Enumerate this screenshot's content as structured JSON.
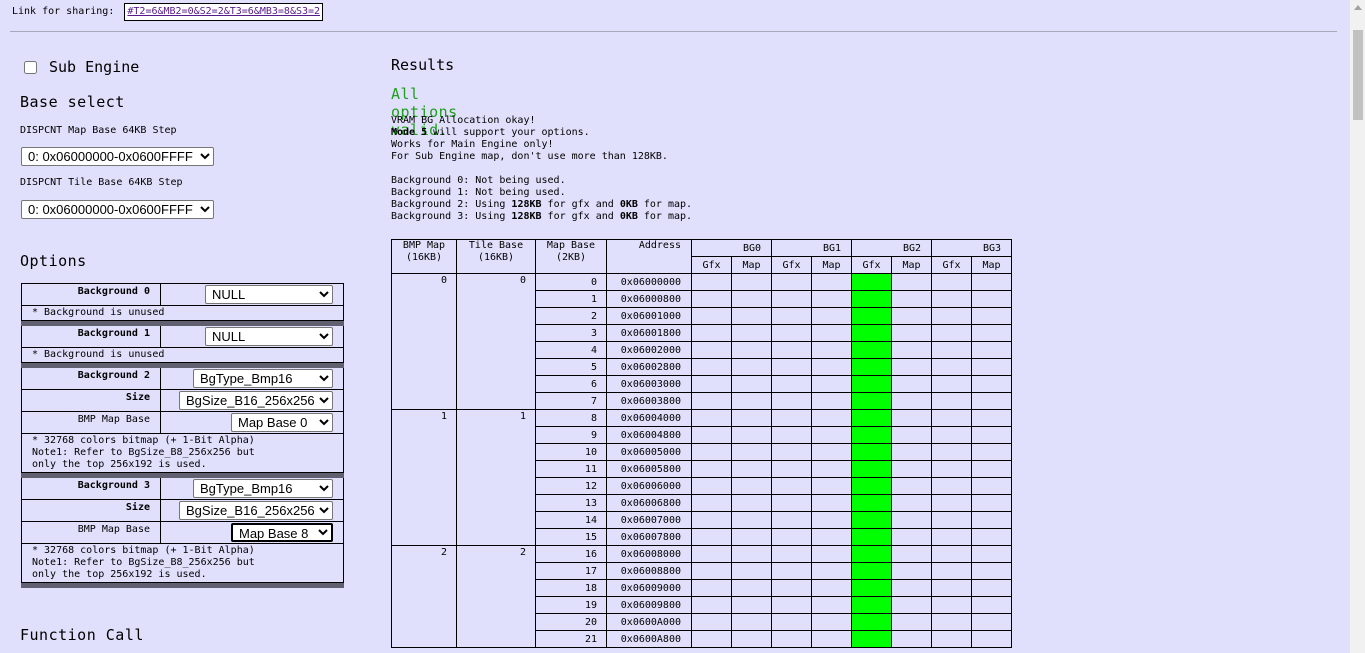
{
  "share": {
    "label": "Link for sharing:",
    "link": "#T2=6&MB2=0&S2=2&T3=6&MB3=8&S3=2"
  },
  "sub_engine": {
    "label": "Sub Engine",
    "checked": false
  },
  "base_select": {
    "title": "Base select",
    "map_base_label": "DISPCNT Map Base 64KB Step",
    "map_base_value": "0: 0x06000000-0x0600FFFF",
    "tile_base_label": "DISPCNT Tile Base 64KB Step",
    "tile_base_value": "0: 0x06000000-0x0600FFFF"
  },
  "options": {
    "title": "Options",
    "bg0": {
      "label": "Background 0",
      "type": "NULL",
      "note": "* Background is unused"
    },
    "bg1": {
      "label": "Background 1",
      "type": "NULL",
      "note": "* Background is unused"
    },
    "bg2": {
      "label": "Background 2",
      "type": "BgType_Bmp16",
      "size_label": "Size",
      "size": "BgSize_B16_256x256",
      "mapbase_label": "BMP Map Base",
      "mapbase": "Map Base 0",
      "note": "* 32768 colors bitmap (+ 1-Bit Alpha)\nNote1: Refer to BgSize_B8_256x256 but\nonly the top 256x192 is used."
    },
    "bg3": {
      "label": "Background 3",
      "type": "BgType_Bmp16",
      "size_label": "Size",
      "size": "BgSize_B16_256x256",
      "mapbase_label": "BMP Map Base",
      "mapbase": "Map Base 8",
      "note": "* 32768 colors bitmap (+ 1-Bit Alpha)\nNote1: Refer to BgSize_B8_256x256 but\nonly the top 256x192 is used."
    }
  },
  "function_call": {
    "title": "Function Call"
  },
  "results": {
    "title": "Results",
    "status": "All options valid.",
    "lines": {
      "l1": "VRAM BG Allocation okay!",
      "l2_bold": "Mode 5",
      "l2_rest": " will support your options.",
      "l3": "Works for Main Engine only!",
      "l4": "For Sub Engine map, don't use more than 128KB.",
      "bg0": "Background 0: Not being used.",
      "bg1": "Background 1: Not being used.",
      "bg2_pre": "Background 2: Using ",
      "bg2_gfx": "128KB",
      "bg2_mid": " for gfx and ",
      "bg2_map": "0KB",
      "bg2_post": " for map.",
      "bg3_pre": "Background 3: Using ",
      "bg3_gfx": "128KB",
      "bg3_mid": " for gfx and ",
      "bg3_map": "0KB",
      "bg3_post": " for map."
    }
  },
  "vram_table": {
    "headers": {
      "bmp_map": "BMP Map",
      "bmp_map_unit": "(16KB)",
      "tile_base": "Tile Base",
      "tile_base_unit": "(16KB)",
      "map_base": "Map Base",
      "map_base_unit": "(2KB)",
      "address": "Address",
      "bg0": "BG0",
      "bg1": "BG1",
      "bg2": "BG2",
      "bg3": "BG3",
      "gfx": "Gfx",
      "map": "Map"
    },
    "rows": [
      {
        "bmp": "0",
        "tile": "0",
        "mb": "0",
        "addr": "0x06000000"
      },
      {
        "mb": "1",
        "addr": "0x06000800"
      },
      {
        "mb": "2",
        "addr": "0x06001000"
      },
      {
        "mb": "3",
        "addr": "0x06001800"
      },
      {
        "mb": "4",
        "addr": "0x06002000"
      },
      {
        "mb": "5",
        "addr": "0x06002800"
      },
      {
        "mb": "6",
        "addr": "0x06003000"
      },
      {
        "mb": "7",
        "addr": "0x06003800"
      },
      {
        "bmp": "1",
        "tile": "1",
        "mb": "8",
        "addr": "0x06004000"
      },
      {
        "mb": "9",
        "addr": "0x06004800"
      },
      {
        "mb": "10",
        "addr": "0x06005000"
      },
      {
        "mb": "11",
        "addr": "0x06005800"
      },
      {
        "mb": "12",
        "addr": "0x06006000"
      },
      {
        "mb": "13",
        "addr": "0x06006800"
      },
      {
        "mb": "14",
        "addr": "0x06007000"
      },
      {
        "mb": "15",
        "addr": "0x06007800"
      },
      {
        "bmp": "2",
        "tile": "2",
        "mb": "16",
        "addr": "0x06008000"
      },
      {
        "mb": "17",
        "addr": "0x06008800"
      },
      {
        "mb": "18",
        "addr": "0x06009000"
      },
      {
        "mb": "19",
        "addr": "0x06009800"
      },
      {
        "mb": "20",
        "addr": "0x0600A000"
      },
      {
        "mb": "21",
        "addr": "0x0600A800"
      }
    ],
    "highlight_color": "#00ff00",
    "highlight_column": "BG2 Gfx"
  }
}
